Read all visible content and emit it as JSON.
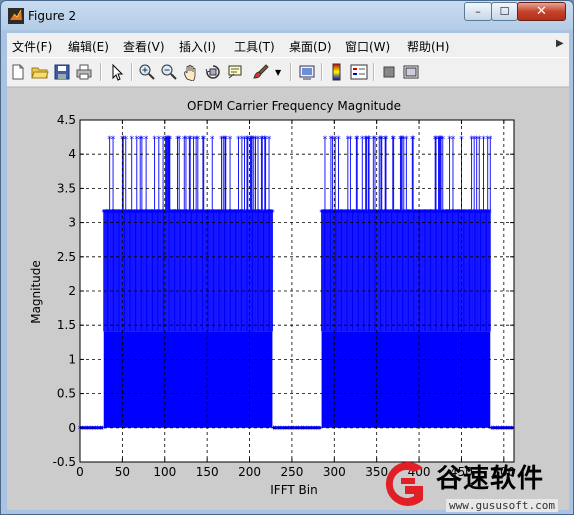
{
  "window": {
    "title": "Figure 2",
    "controls": {
      "minimize": "–",
      "maximize": "☐",
      "close": "✕"
    }
  },
  "menubar": {
    "items": [
      "文件(F)",
      "编辑(E)",
      "查看(V)",
      "插入(I)",
      "工具(T)",
      "桌面(D)",
      "窗口(W)",
      "帮助(H)"
    ],
    "overflow_icon": "arrow-icon"
  },
  "toolbar": {
    "buttons": [
      "new-figure-icon",
      "open-icon",
      "save-icon",
      "print-icon",
      "edit-plot-arrow-icon",
      "zoom-in-icon",
      "zoom-out-icon",
      "pan-hand-icon",
      "rotate-3d-icon",
      "data-cursor-icon",
      "brush-icon",
      "brush-dropdown-icon",
      "link-plot-icon",
      "colorbar-icon",
      "legend-icon",
      "hide-plot-tools-icon",
      "show-plot-tools-icon"
    ]
  },
  "chart_data": {
    "type": "line",
    "title": "OFDM Carrier Frequency Magnitude",
    "xlabel": "IFFT Bin",
    "ylabel": "Magnitude",
    "xlim": [
      0,
      512
    ],
    "ylim": [
      -0.5,
      4.5
    ],
    "xticks": [
      0,
      50,
      100,
      150,
      200,
      250,
      300,
      350,
      400,
      450,
      500
    ],
    "yticks": [
      -0.5,
      0,
      0.5,
      1,
      1.5,
      2,
      2.5,
      3,
      3.5,
      4,
      4.5
    ],
    "grid": true,
    "marker": "*",
    "color": "#0000ff",
    "series": [
      {
        "segments": [
          {
            "x_range": [
              0,
              27
            ],
            "y_value": 0
          },
          {
            "x_range": [
              28,
              227
            ],
            "y_levels": [
              1.41,
              3.16,
              4.24
            ]
          },
          {
            "x_range": [
              228,
              284
            ],
            "y_value": 0
          },
          {
            "x_range": [
              285,
              484
            ],
            "y_levels": [
              1.41,
              3.16,
              4.24
            ]
          },
          {
            "x_range": [
              485,
              511
            ],
            "y_value": 0
          }
        ]
      }
    ]
  },
  "watermark": {
    "text": "谷速软件",
    "url": "www.gususoft.com"
  }
}
